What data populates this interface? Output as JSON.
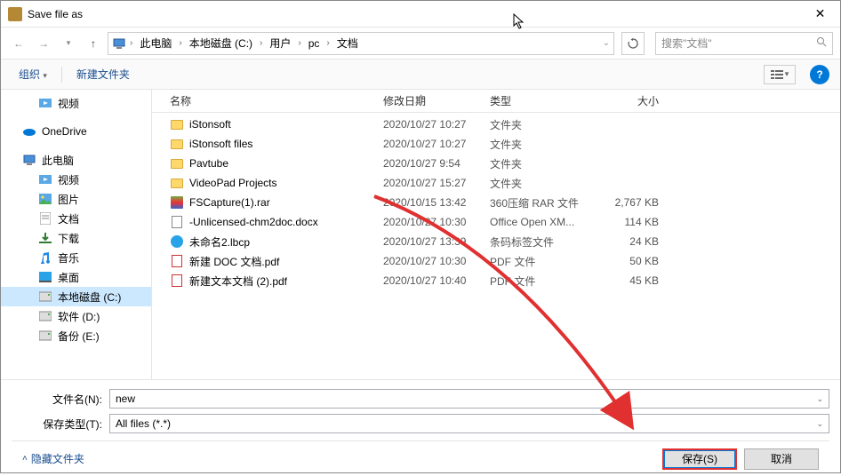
{
  "window": {
    "title": "Save file as"
  },
  "nav": {
    "breadcrumb": [
      "此电脑",
      "本地磁盘 (C:)",
      "用户",
      "pc",
      "文档"
    ],
    "search_placeholder": "搜索\"文档\""
  },
  "toolbar": {
    "organize": "组织",
    "new_folder": "新建文件夹"
  },
  "sidebar": {
    "items": [
      {
        "icon": "video",
        "label": "视频",
        "indent": true
      },
      {
        "icon": "onedrive",
        "label": "OneDrive",
        "indent": false,
        "top_gap": true
      },
      {
        "icon": "pc",
        "label": "此电脑",
        "indent": false,
        "top_gap": true
      },
      {
        "icon": "video",
        "label": "视频",
        "indent": true
      },
      {
        "icon": "pictures",
        "label": "图片",
        "indent": true
      },
      {
        "icon": "documents",
        "label": "文档",
        "indent": true
      },
      {
        "icon": "downloads",
        "label": "下载",
        "indent": true
      },
      {
        "icon": "music",
        "label": "音乐",
        "indent": true
      },
      {
        "icon": "desktop",
        "label": "桌面",
        "indent": true
      },
      {
        "icon": "disk",
        "label": "本地磁盘 (C:)",
        "indent": true,
        "selected": true
      },
      {
        "icon": "disk",
        "label": "软件 (D:)",
        "indent": true
      },
      {
        "icon": "disk",
        "label": "备份 (E:)",
        "indent": true
      }
    ]
  },
  "columns": {
    "name": "名称",
    "date": "修改日期",
    "type": "类型",
    "size": "大小"
  },
  "files": [
    {
      "icon": "folder",
      "name": "iStonsoft",
      "date": "2020/10/27 10:27",
      "type": "文件夹",
      "size": ""
    },
    {
      "icon": "folder",
      "name": "iStonsoft files",
      "date": "2020/10/27 10:27",
      "type": "文件夹",
      "size": ""
    },
    {
      "icon": "folder",
      "name": "Pavtube",
      "date": "2020/10/27 9:54",
      "type": "文件夹",
      "size": ""
    },
    {
      "icon": "folder",
      "name": "VideoPad Projects",
      "date": "2020/10/27 15:27",
      "type": "文件夹",
      "size": ""
    },
    {
      "icon": "rar",
      "name": "FSCapture(1).rar",
      "date": "2020/10/15 13:42",
      "type": "360压缩 RAR 文件",
      "size": "2,767 KB"
    },
    {
      "icon": "docx",
      "name": "-Unlicensed-chm2doc.docx",
      "date": "2020/10/27 10:30",
      "type": "Office Open XM...",
      "size": "114 KB"
    },
    {
      "icon": "lbcp",
      "name": "未命名2.lbcp",
      "date": "2020/10/27 13:39",
      "type": "条码标签文件",
      "size": "24 KB"
    },
    {
      "icon": "pdf",
      "name": "新建 DOC 文档.pdf",
      "date": "2020/10/27 10:30",
      "type": "PDF 文件",
      "size": "50 KB"
    },
    {
      "icon": "pdf",
      "name": "新建文本文档 (2).pdf",
      "date": "2020/10/27 10:40",
      "type": "PDF 文件",
      "size": "45 KB"
    }
  ],
  "fields": {
    "filename_label": "文件名(N):",
    "filename_value": "new",
    "filetype_label": "保存类型(T):",
    "filetype_value": "All files (*.*)"
  },
  "footer": {
    "hide_folders": "隐藏文件夹",
    "save": "保存(S)",
    "cancel": "取消"
  }
}
